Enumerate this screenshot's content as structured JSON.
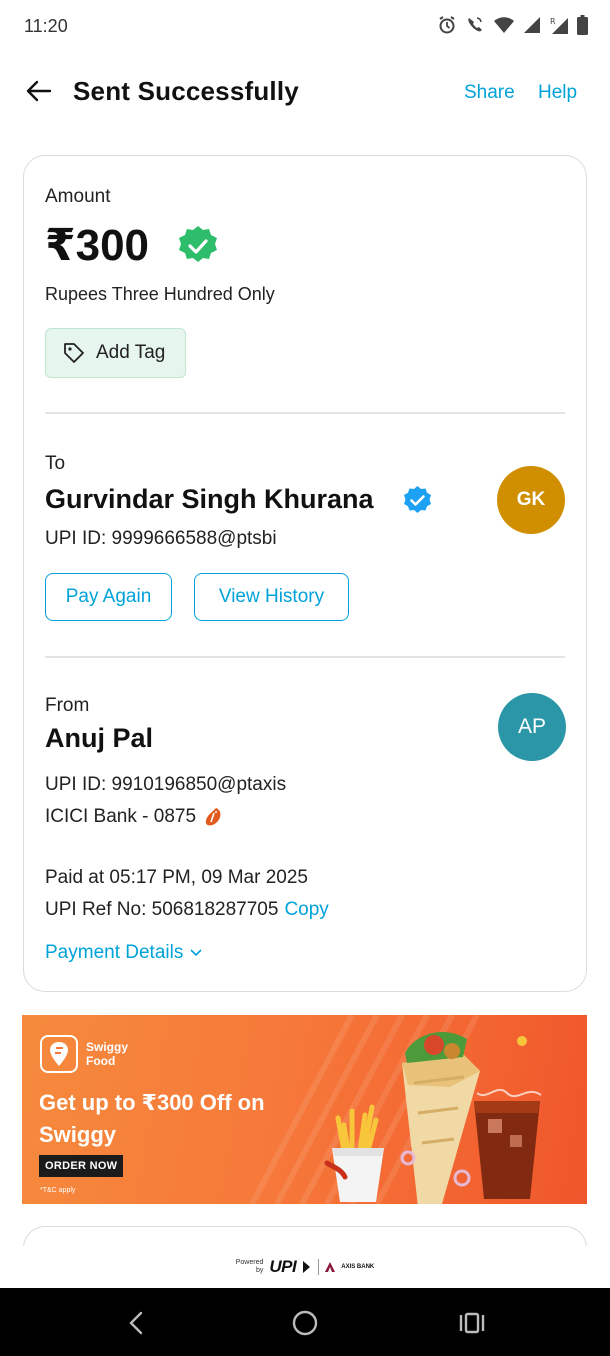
{
  "status_bar": {
    "time": "11:20",
    "icons": [
      "alarm-icon",
      "wifi-calling-icon",
      "wifi-icon",
      "signal-icon",
      "signal-roaming-icon",
      "battery-icon"
    ]
  },
  "header": {
    "title": "Sent Successfully",
    "share": "Share",
    "help": "Help"
  },
  "amount": {
    "label": "Amount",
    "value": "₹300",
    "in_words": "Rupees Three Hundred Only",
    "tag_button": "Add Tag"
  },
  "payee": {
    "label": "To",
    "name": "Gurvindar Singh Khurana",
    "upi_id": "UPI ID: 9999666588@ptsbi",
    "initials": "GK",
    "avatar_color": "#cf8f00"
  },
  "actions": {
    "pay_again": "Pay Again",
    "view_history": "View History"
  },
  "payer": {
    "label": "From",
    "name": "Anuj Pal",
    "upi_id": "UPI ID: 9910196850@ptaxis",
    "bank": "ICICI Bank - 0875",
    "initials": "AP",
    "avatar_color": "#2a96a8"
  },
  "transaction": {
    "paid_at": "Paid at 05:17 PM, 09 Mar 2025",
    "ref_label": "UPI Ref No: 506818287705",
    "copy": "Copy",
    "details_link": "Payment Details"
  },
  "banner": {
    "brand_line1": "Swiggy",
    "brand_line2": "Food",
    "headline": "Get up to ₹300 Off on Swiggy",
    "cta": "ORDER NOW",
    "tnc": "*T&C apply"
  },
  "footer": {
    "powered_line1": "Powered",
    "powered_line2": "by",
    "upi": "UPI",
    "bank": "AXIS BANK"
  },
  "colors": {
    "accent": "#00a3d9",
    "success": "#2ebd6b",
    "verified": "#1da1f2"
  }
}
